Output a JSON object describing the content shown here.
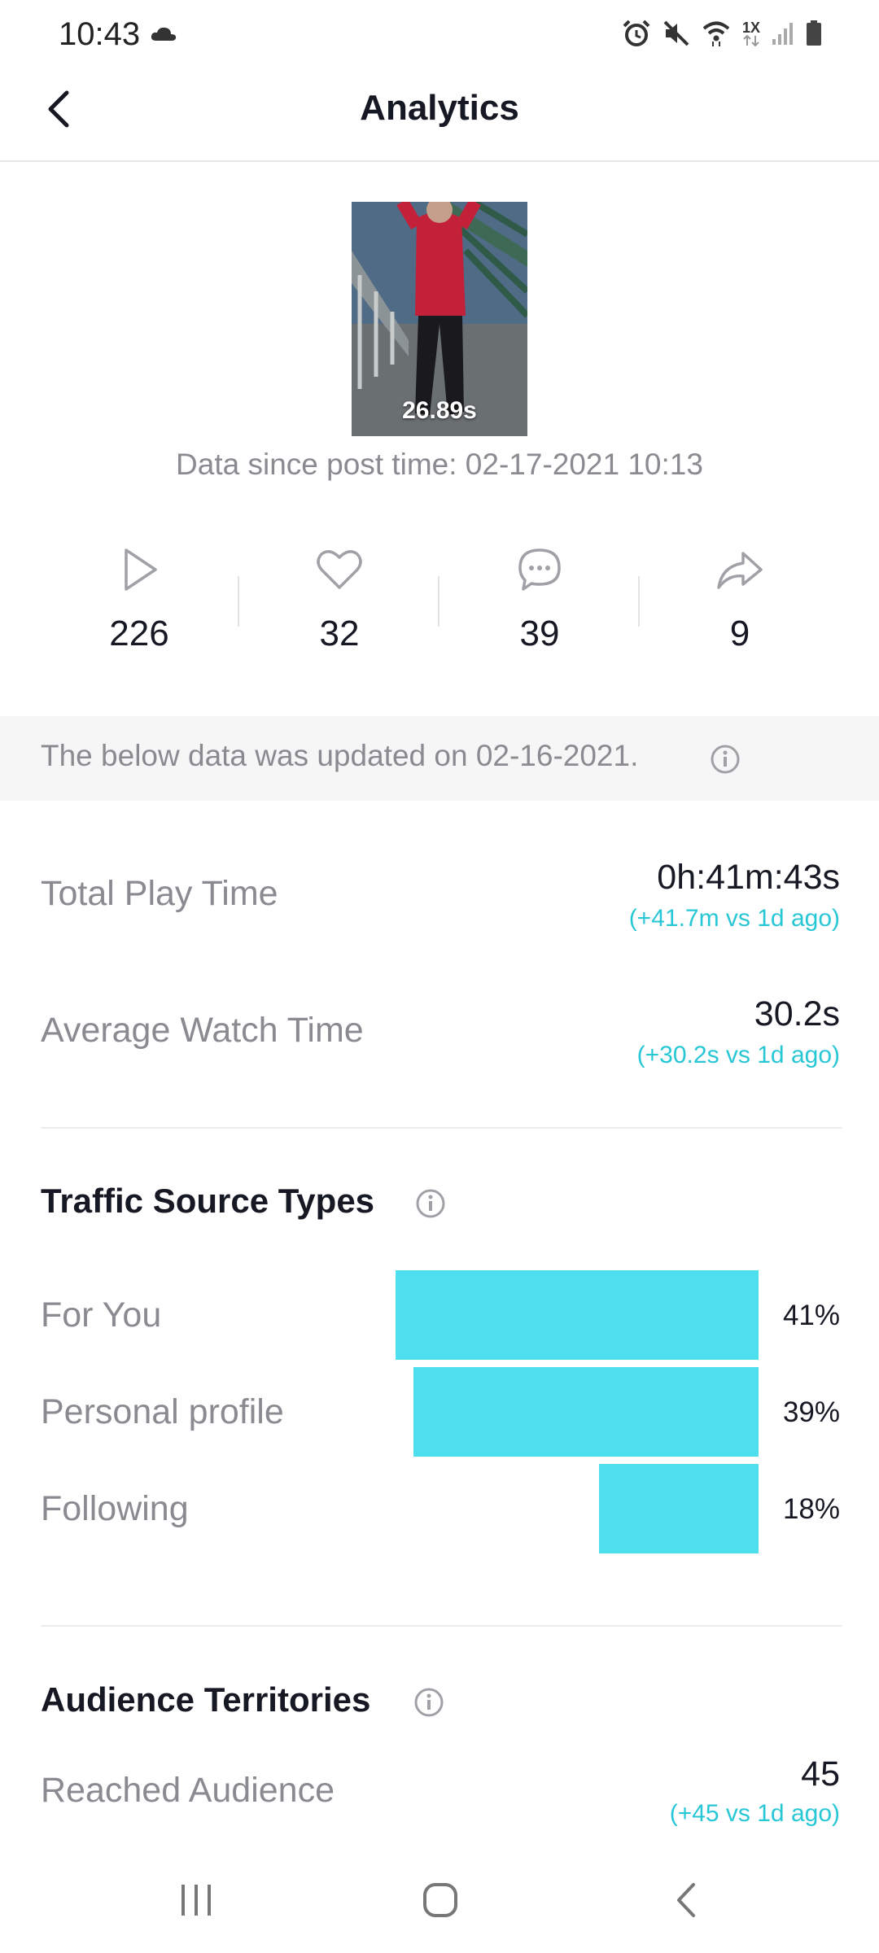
{
  "status_bar": {
    "time": "10:43",
    "icons": [
      "cloud-icon",
      "alarm-icon",
      "mute-icon",
      "wifi-icon",
      "network-icon",
      "signal-icon",
      "battery-icon"
    ],
    "speed_label": "1X"
  },
  "header": {
    "title": "Analytics",
    "back_icon": "chevron-left-icon"
  },
  "video": {
    "duration": "26.89s",
    "since_text": "Data since post time: 02-17-2021 10:13"
  },
  "stats": [
    {
      "icon": "play-icon",
      "value": "226"
    },
    {
      "icon": "heart-icon",
      "value": "32"
    },
    {
      "icon": "comment-icon",
      "value": "39"
    },
    {
      "icon": "share-icon",
      "value": "9"
    }
  ],
  "banner": {
    "text": "The below data was updated on 02-16-2021.",
    "icon": "info-icon"
  },
  "metrics": [
    {
      "label": "Total Play Time",
      "value": "0h:41m:43s",
      "delta": "(+41.7m vs 1d ago)"
    },
    {
      "label": "Average Watch Time",
      "value": "30.2s",
      "delta": "(+30.2s vs 1d ago)"
    }
  ],
  "traffic": {
    "title": "Traffic Source Types",
    "accent": "#4ddfed",
    "items": [
      {
        "label": "For You",
        "pct_label": "41%",
        "share": 41
      },
      {
        "label": "Personal profile",
        "pct_label": "39%",
        "share": 39
      },
      {
        "label": "Following",
        "pct_label": "18%",
        "share": 18
      }
    ]
  },
  "audience": {
    "title": "Audience Territories",
    "label": "Reached Audience",
    "value": "45",
    "delta": "(+45 vs 1d ago)"
  },
  "colors": {
    "delta": "#28c7d6",
    "muted": "#8a8b91",
    "text": "#161823"
  },
  "nav": [
    "recent-apps-icon",
    "home-icon",
    "back-icon"
  ]
}
